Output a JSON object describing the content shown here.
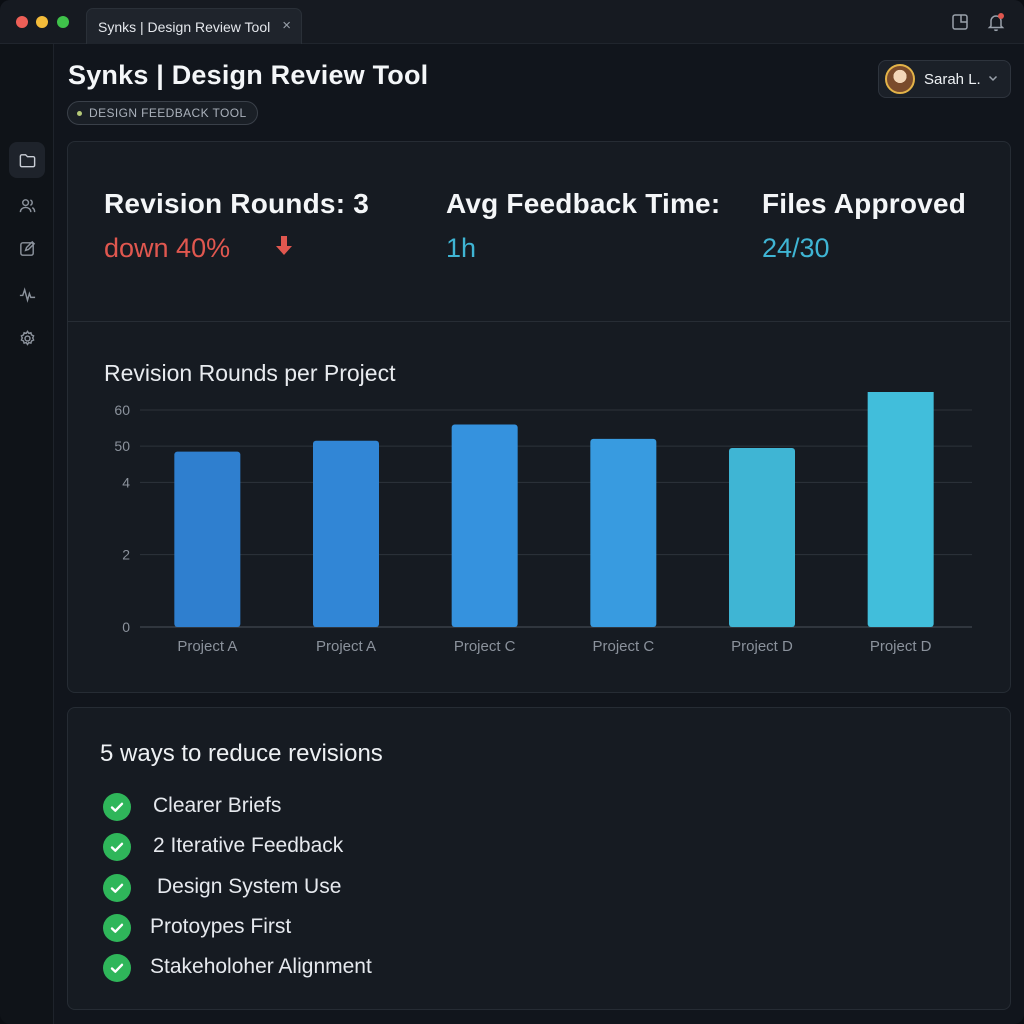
{
  "window": {
    "tab_title": "Synks | Design Review Tool",
    "tab_close": "×"
  },
  "header": {
    "title": "Synks | Design Review Tool",
    "badge": "DESIGN FEEDBACK TOOL",
    "user_name": "Sarah L."
  },
  "sidebar": {
    "items": [
      {
        "icon": "folder-icon",
        "active": true
      },
      {
        "icon": "users-icon",
        "active": false
      },
      {
        "icon": "edit-icon",
        "active": false
      },
      {
        "icon": "activity-icon",
        "active": false
      },
      {
        "icon": "gear-icon",
        "active": false
      }
    ]
  },
  "stats": [
    {
      "label": "Revision Rounds: 3",
      "value": "down 40%",
      "color": "#e0574f",
      "trend": "down"
    },
    {
      "label": "Avg Feedback Time:",
      "value": "1h",
      "color": "#3fb5d4"
    },
    {
      "label": "Files Approved",
      "value": "24/30",
      "color": "#3fb5d4"
    }
  ],
  "chart_data": {
    "type": "bar",
    "title": "Revision Rounds per Project",
    "categories": [
      "Project A",
      "Project A",
      "Project C",
      "Project C",
      "Project D",
      "Project D"
    ],
    "values": [
      48.5,
      51.5,
      56,
      52,
      49.5,
      67
    ],
    "ytick_labels": [
      "0",
      "2",
      "4",
      "50",
      "60"
    ],
    "ytick_values": [
      0,
      20,
      40,
      50,
      60
    ],
    "ylim": [
      0,
      60
    ],
    "grid": true,
    "bar_colors": [
      "#2f7fcf",
      "#3186d6",
      "#3592de",
      "#389be0",
      "#3fb5d4",
      "#41bedb"
    ]
  },
  "tips": {
    "title": "5 ways to reduce revisions",
    "items": [
      "Clearer Briefs",
      "2 Iterative Feedback",
      "Design System Use",
      "Protoypes First",
      "Stakeholoher Alignment"
    ]
  }
}
